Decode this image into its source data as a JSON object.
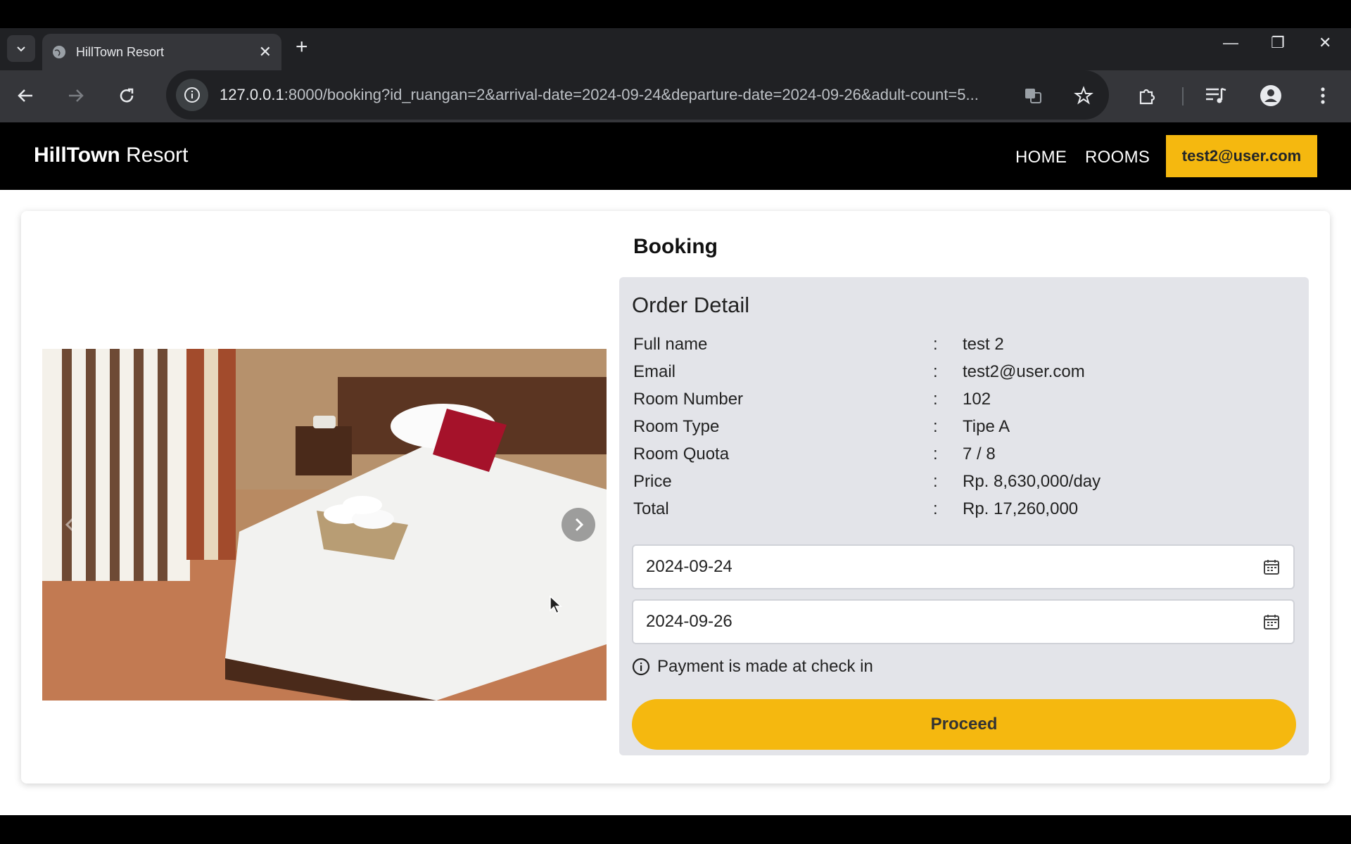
{
  "browser": {
    "tab_title": "HillTown Resort",
    "url_host": "127.0.0.1",
    "url_rest": ":8000/booking?id_ruangan=2&arrival-date=2024-09-24&departure-date=2024-09-26&adult-count=5..."
  },
  "site": {
    "brand_bold": "HillTown",
    "brand_light": "Resort",
    "nav": {
      "home": "HOME",
      "rooms": "ROOMS"
    },
    "user_email": "test2@user.com"
  },
  "booking": {
    "title": "Booking",
    "order_title": "Order Detail",
    "fields": [
      {
        "label": "Full name",
        "value": "test 2"
      },
      {
        "label": "Email",
        "value": "test2@user.com"
      },
      {
        "label": "Room Number",
        "value": "102"
      },
      {
        "label": "Room Type",
        "value": "Tipe A"
      },
      {
        "label": "Room Quota",
        "value": "7 / 8"
      },
      {
        "label": "Price",
        "value": "Rp. 8,630,000/day"
      },
      {
        "label": "Total",
        "value": "Rp. 17,260,000"
      }
    ],
    "colon": ":",
    "arrival_date": "2024-09-24",
    "departure_date": "2024-09-26",
    "payment_note": "Payment is made at check in",
    "proceed_label": "Proceed"
  },
  "colors": {
    "accent": "#f5b80f",
    "panel": "#e3e4e9"
  },
  "icons": [
    "tab-list-icon",
    "globe-icon",
    "close-icon",
    "plus-icon",
    "back-icon",
    "forward-icon",
    "reload-icon",
    "info-icon",
    "translate-icon",
    "star-icon",
    "extensions-icon",
    "media-icon",
    "profile-icon",
    "menu-icon",
    "calendar-icon",
    "chevron-left-icon",
    "chevron-right-icon"
  ]
}
